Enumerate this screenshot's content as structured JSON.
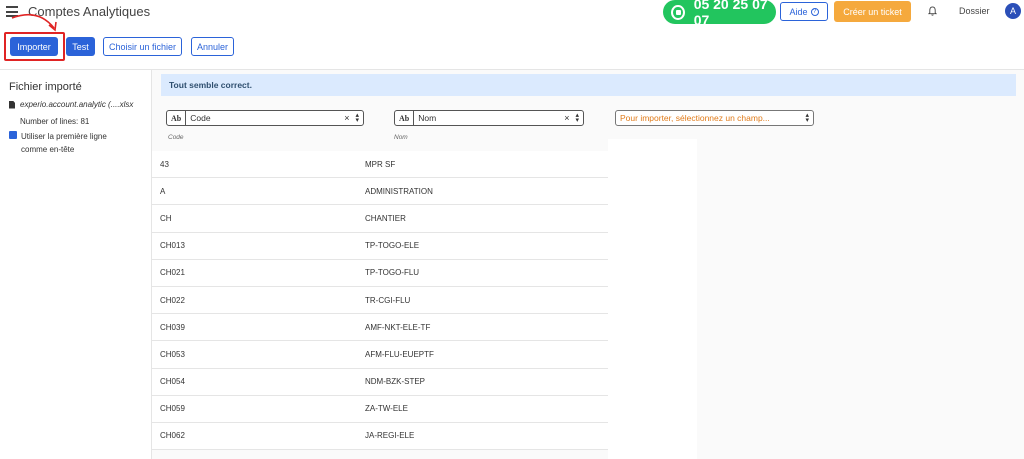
{
  "header": {
    "title": "Comptes Analytiques",
    "phone": "05 20 25 07 07",
    "help_label": "Aide",
    "ticket_label": "Créer un ticket",
    "folder_label": "Dossier",
    "avatar_initial": "A"
  },
  "toolbar": {
    "import_label": "Importer",
    "test_label": "Test",
    "choose_file_label": "Choisir un fichier",
    "cancel_label": "Annuler"
  },
  "sidebar": {
    "title": "Fichier importé",
    "file_name": "experio.account.analytic (....xlsx",
    "line_count": "Number of lines: 81",
    "first_line_header_label": "Utiliser la première ligne comme en-tête",
    "first_line_header_checked": true
  },
  "main": {
    "alert": "Tout semble correct.",
    "fields": [
      {
        "badge": "Ab",
        "name": "Code",
        "sub": "Code"
      },
      {
        "badge": "Ab",
        "name": "Nom",
        "sub": "Nom"
      },
      {
        "placeholder": "Pour importer, sélectionnez un champ..."
      }
    ],
    "rows": [
      [
        "43",
        "MPR SF"
      ],
      [
        "A",
        "ADMINISTRATION"
      ],
      [
        "CH",
        "CHANTIER"
      ],
      [
        "CH013",
        "TP-TOGO-ELE"
      ],
      [
        "CH021",
        "TP-TOGO-FLU"
      ],
      [
        "CH022",
        "TR-CGI-FLU"
      ],
      [
        "CH039",
        "AMF-NKT-ELE-TF"
      ],
      [
        "CH053",
        "AFM-FLU-EUEPTF"
      ],
      [
        "CH054",
        "NDM-BZK-STEP"
      ],
      [
        "CH059",
        "ZA-TW-ELE"
      ],
      [
        "CH062",
        "JA-REGI-ELE"
      ]
    ]
  },
  "colors": {
    "primary": "#2b63d9",
    "phone_green": "#22c55e",
    "ticket_orange": "#f5a93d",
    "highlight_red": "#e02424",
    "alert_bg": "#dbeafe"
  }
}
